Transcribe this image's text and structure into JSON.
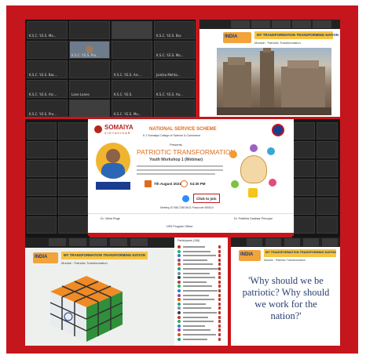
{
  "top_left_grid": {
    "tiles": [
      "K.S.C. Y.E.S. Ma...",
      "",
      "",
      "K.S.C. Y.E.S. Bsc",
      "",
      "K.S.C. Y.E.S. Pro...",
      "",
      "K.S.C. Y.E.S. Ma...",
      "K.S.C. Y.E.S. Bac...",
      "",
      "K.S.C. Y.E.S. Arc...",
      "Jainika Mehta...",
      "K.S.C. Y.E.S. Arc...",
      "Lane Lanes",
      "K.S.C. Y.E.S.",
      "K.S.C. Y.E.S. Aa...",
      "K.S.C. Y.E.S. Pro...",
      "",
      "K.S.C. Y.E.S. Ma...",
      ""
    ]
  },
  "top_right_slide": {
    "logo_text": "INDIA",
    "title": "MY TRANSFORMATION TRANSFORMING NATION",
    "module_label": "Module : Patriotic Transformation"
  },
  "center_poster": {
    "brand": "SOMAIYA",
    "brand_sub": "VIDYAVIHAR",
    "nss": "NATIONAL SERVICE SCHEME",
    "college": "K J Somaiya College of Science & Commerce",
    "presents": "Presents",
    "headline": "PATRIOTIC TRANSFORMATION",
    "subheadline": "Youth Workshop 1 (Webinar)",
    "date": "7th August 2021",
    "time": "04:30 PM",
    "cta": "Click to join",
    "meeting": "Meeting ID 988 2380 8611  Passcode 550610",
    "footer_left": "Dr. Vibha Pinge",
    "footer_center": "NSS Program Officer",
    "footer_right": "Dr. Pratibha Gadekar Principal"
  },
  "bottom_left_slide": {
    "logo_text": "INDIA",
    "title": "MY TRANSFORMATION TRANSFORMING NATION",
    "module_label": "Module : Patriotic Transformation"
  },
  "bottom_right_slide": {
    "logo_text": "INDIA",
    "title": "MY TRANSFORMATION TRANSFORMING NATION",
    "module_label": "Module : Patriotic Transformation",
    "quote": "'Why should we be patriotic? Why should we work for the nation?'"
  },
  "participants_panel": {
    "header": "Participants (156)"
  },
  "colors": {
    "border_red": "#c4161c",
    "dark": "#1d1d1d",
    "poster_orange": "#e06a1b"
  }
}
